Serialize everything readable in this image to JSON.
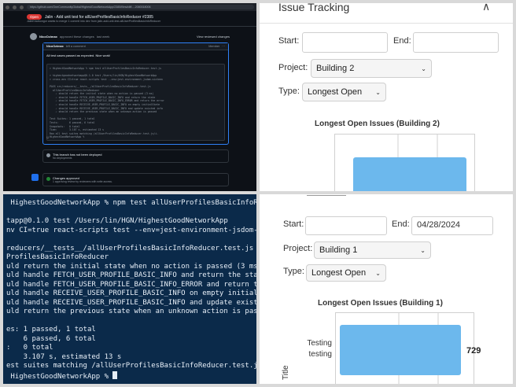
{
  "github": {
    "url": "https://github.com/OneCommunityGlobal/HighestGoodNetworkApp/2385/files#diff-...2080018006",
    "status_badge": "Open",
    "pr_title": "Jalin - Add unit test for allUserProfilesBasicInfoReducer #2385",
    "pr_subtitle": "JalinKharkongor wants to merge 1 commit into dev from jalin-add-unit-test-allUserProfilesBasicInfoReducer",
    "reviewer": "NicoOzimax",
    "review_action": "approved these changes",
    "review_time": "last week",
    "view_changes": "View reviewed changes",
    "comment_author": "NicoOzimax",
    "comment_meta": "left a comment",
    "comment_role": "Member",
    "comment_text": "All test cases passed as expected. Nice work!",
    "code_lines": [
      "> HighestGoodNetworkApp % npm test allUserProfilesBasicInfoReducer.test.js",
      "",
      "> highestgoodnetworkapp@0.1.0 test /Users/lin/HGN/HighestGoodNetworkApp",
      "> cross-env CI=true react-scripts test --env=jest-environment-jsdom-sixteen",
      "",
      "PASS src/reducers/__tests__/allUserProfilesBasicInfoReducer.test.js",
      "  allUserProfilesBasicInfoReducer",
      "    ✓ should return the initial state when no action is passed (3 ms)",
      "    ✓ should handle FETCH_USER_PROFILE_BASIC_INFO and return the state",
      "    ✓ should handle FETCH_USER_PROFILE_BASIC_INFO_ERROR and return the error",
      "    ✓ should handle RECEIVE_USER_PROFILE_BASIC_INFO on empty initialState",
      "    ✓ should handle RECEIVE_USER_PROFILE_BASIC_INFO and update existed info",
      "    ✓ should return the previous state when an unknown action is passed",
      "",
      "Test Suites: 1 passed, 1 total",
      "Tests:       6 passed, 6 total",
      "Snapshots:   0 total",
      "Time:        3.107 s, estimated 13 s",
      "Ran all test suites matching /allUserProfilesBasicInfoReducer.test.js/i.",
      "HighestGoodNetworkApp %"
    ],
    "deploy_title": "This branch has not been deployed",
    "deploy_sub": "No deployments",
    "approval_title": "Changes approved",
    "approval_sub": "1 approving review by reviewers with write access."
  },
  "terminal": {
    "lines": [
      " HighestGoodNetworkApp % npm test allUserProfilesBasicInfoReducer",
      "",
      "tapp@0.1.0 test /Users/lin/HGN/HighestGoodNetworkApp",
      "nv CI=true react-scripts test --env=jest-environment-jsdom-sixt",
      "",
      "reducers/__tests__/allUserProfilesBasicInfoReducer.test.js",
      "ProfilesBasicInfoReducer",
      "uld return the initial state when no action is passed (3 ms)",
      "uld handle FETCH_USER_PROFILE_BASIC_INFO and return the state (",
      "uld handle FETCH_USER_PROFILE_BASIC_INFO_ERROR and return the e",
      "uld handle RECEIVE_USER_PROFILE_BASIC_INFO on empty initialStat",
      "uld handle RECEIVE_USER_PROFILE_BASIC_INFO and update existed i",
      "uld return the previous state when an unknown action is passed",
      "",
      "es: 1 passed, 1 total",
      "    6 passed, 6 total",
      ":   0 total",
      "    3.107 s, estimated 13 s",
      "est suites matching /allUserProfilesBasicInfoReducer.test.js/i.",
      " HighestGoodNetworkApp % "
    ]
  },
  "issue_top": {
    "header": "Issue Tracking",
    "collapse_icon": "chevron-up-icon",
    "start_label": "Start:",
    "start_value": "",
    "end_label": "End:",
    "end_value": "",
    "project_label": "Project:",
    "project_value": "Building 2",
    "type_label": "Type:",
    "type_value": "Longest Open",
    "chart_title": "Longest Open Issues (Building 2)"
  },
  "issue_bottom": {
    "start_label": "Start:",
    "start_value": "",
    "end_label": "End:",
    "end_value": "04/28/2024",
    "project_label": "Project:",
    "project_value": "Building 1",
    "type_label": "Type:",
    "type_value": "Longest Open",
    "chart_title": "Longest Open Issues (Building 1)",
    "y_axis_label": "Title"
  },
  "chart_data": [
    {
      "type": "bar",
      "orientation": "horizontal",
      "title": "Longest Open Issues (Building 2)",
      "categories": [
        ""
      ],
      "values": [
        null
      ],
      "grid": true,
      "color": "#6cb8ed"
    },
    {
      "type": "bar",
      "orientation": "horizontal",
      "title": "Longest Open Issues (Building 1)",
      "categories": [
        "Testing testing"
      ],
      "values": [
        729
      ],
      "ylabel": "Title",
      "grid": true,
      "color": "#6cb8ed"
    }
  ],
  "colors": {
    "terminal_bg": "#0b2a4a",
    "github_bg": "#0d1117",
    "bar": "#6cb8ed",
    "open_badge": "#da3633"
  }
}
